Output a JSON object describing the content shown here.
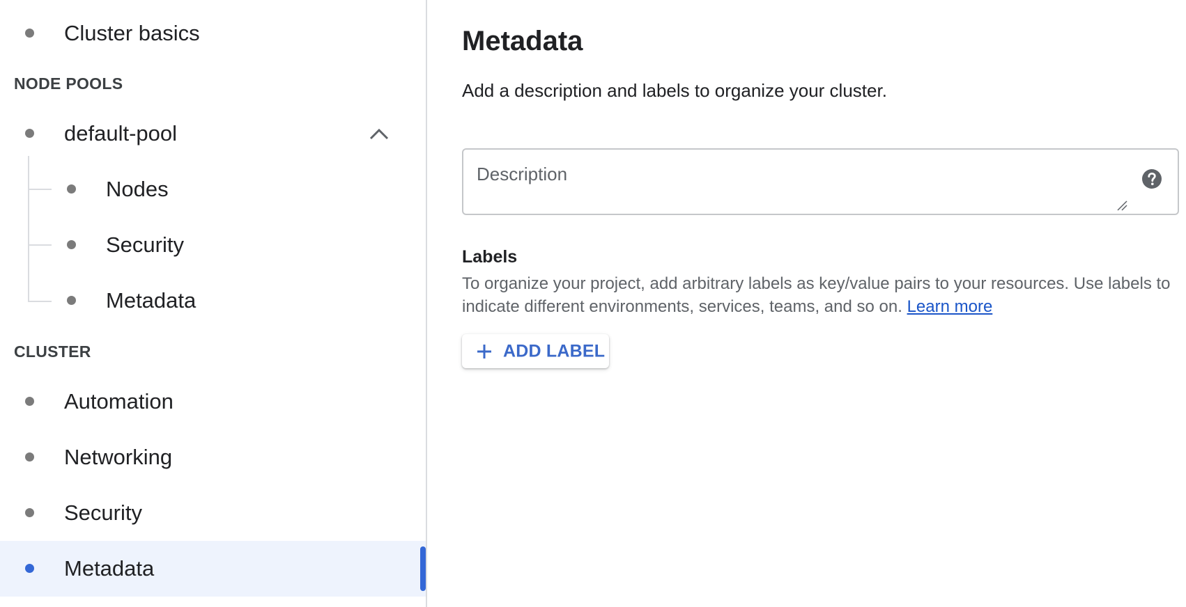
{
  "sidebar": {
    "top_item": "Cluster basics",
    "node_pools_header": "NODE POOLS",
    "pool": {
      "label": "default-pool",
      "children": [
        "Nodes",
        "Security",
        "Metadata"
      ]
    },
    "cluster_header": "CLUSTER",
    "cluster_items": [
      "Automation",
      "Networking",
      "Security",
      "Metadata"
    ],
    "active_item": "Metadata"
  },
  "main": {
    "title": "Metadata",
    "subtitle": "Add a description and labels to organize your cluster.",
    "description": {
      "placeholder": "Description",
      "value": ""
    },
    "labels": {
      "title": "Labels",
      "description": "To organize your project, add arbitrary labels as key/value pairs to your resources. Use labels to indicate different environments, services, teams, and so on.",
      "learn_more": "Learn more",
      "add_button": "ADD LABEL"
    }
  },
  "colors": {
    "accent": "#3367d6",
    "active_bg": "#eef3fd",
    "link": "#1a55c8"
  },
  "icons": {
    "chevron": "chevron-up-icon",
    "help": "help-icon",
    "add": "plus-icon"
  }
}
